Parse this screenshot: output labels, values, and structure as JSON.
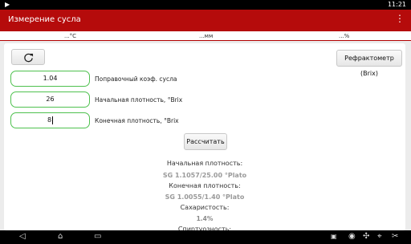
{
  "status_bar": {
    "time": "11:21"
  },
  "app_bar": {
    "title": "Измерение сусла",
    "menu_icon": "overflow-menu-icon"
  },
  "units_bar": {
    "temperature": "...°C",
    "length": "...мм",
    "percent": "...%"
  },
  "form": {
    "refresh_icon": "refresh-icon",
    "refractometer_button": "Рефрактометр (Brix)",
    "correction": {
      "value": "1.04",
      "label": "Поправочный коэф. сусла"
    },
    "original_gravity": {
      "value": "26",
      "label": "Начальная плотность, °Brix"
    },
    "final_gravity": {
      "value": "8",
      "label": "Конечная плотность, °Brix"
    },
    "calculate_button": "Рассчитать"
  },
  "results": {
    "og_label": "Начальная плотность:",
    "og_value": "SG 1.1057/25.00 °Plato",
    "fg_label": "Конечная плотность:",
    "fg_value": "SG 1.0055/1.40 °Plato",
    "sugar_label": "Сахаристость:",
    "sugar_value": "1.4%",
    "alcohol_label": "Спиртуозность:"
  },
  "nav_bar": {
    "icons": [
      "back-icon",
      "home-icon",
      "recent-apps-icon",
      "screenshot-icon",
      "eye-icon",
      "compass-icon",
      "location-icon",
      "cut-icon"
    ]
  }
}
